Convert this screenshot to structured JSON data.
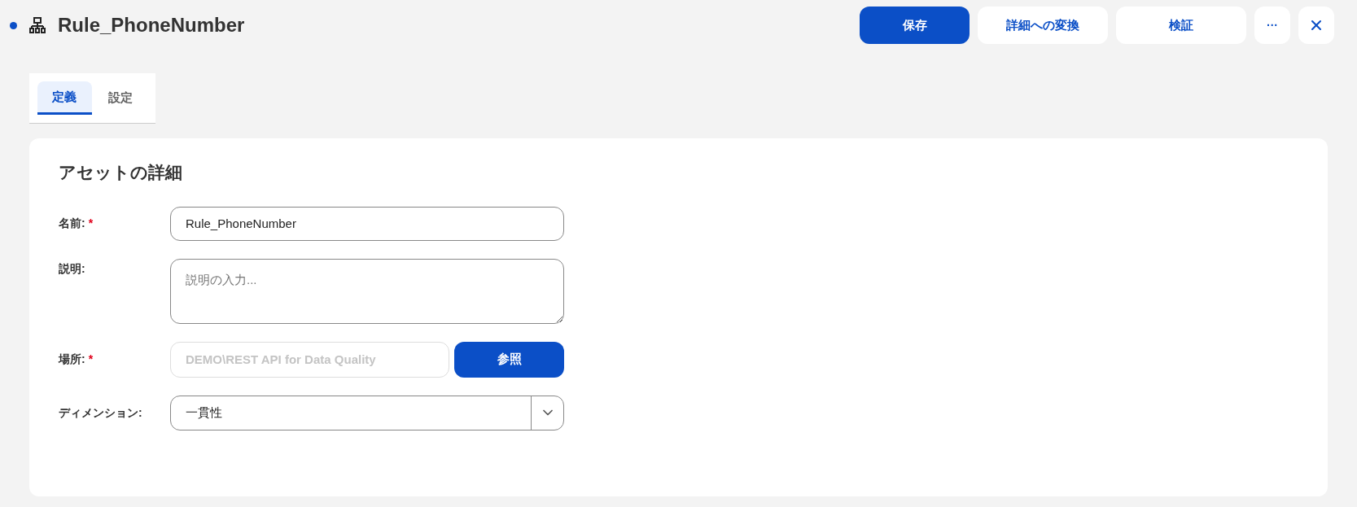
{
  "header": {
    "title": "Rule_PhoneNumber",
    "unsaved": true,
    "buttons": [
      {
        "label": "保存",
        "kind": "primary"
      },
      {
        "label": "詳細への変換",
        "kind": "secondary"
      },
      {
        "label": "検証",
        "kind": "secondary"
      },
      {
        "label": "···",
        "kind": "more"
      },
      {
        "kind": "close"
      }
    ]
  },
  "tabs": [
    {
      "label": "定義",
      "selected": true
    },
    {
      "label": "設定",
      "selected": false
    }
  ],
  "card": {
    "title": "アセットの詳細",
    "fields": [
      {
        "kind": "text",
        "label": "名前:",
        "required_mark": "*",
        "value": "Rule_PhoneNumber"
      },
      {
        "kind": "textarea",
        "label": "説明:",
        "placeholder": "説明の入力..."
      },
      {
        "kind": "location",
        "label": "場所:",
        "required_mark": "*",
        "value": "DEMO\\REST API for Data Quality",
        "disabled": true,
        "button": "参照"
      },
      {
        "kind": "select",
        "label": "ディメンション:",
        "value": "一貫性"
      }
    ]
  }
}
